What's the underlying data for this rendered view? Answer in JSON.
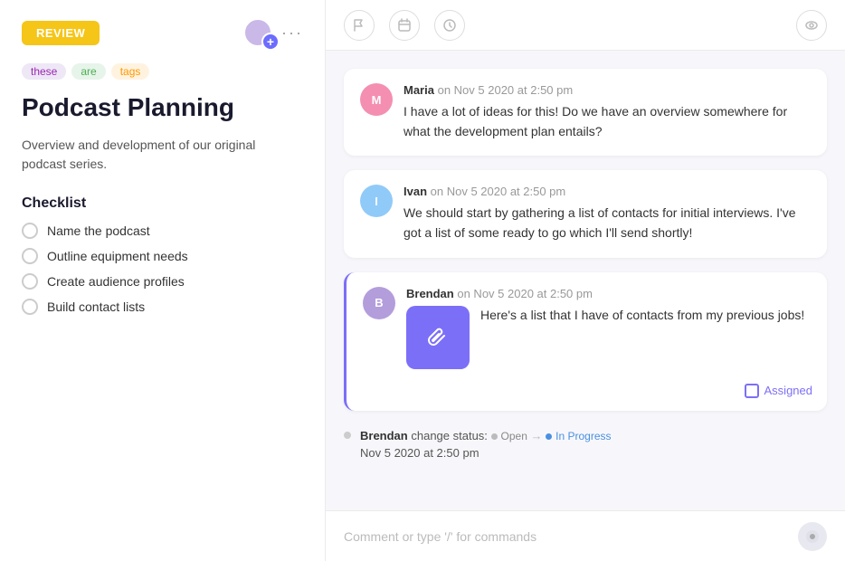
{
  "left": {
    "review_button": "REVIEW",
    "more_dots": "···",
    "tags": [
      {
        "label": "these",
        "style": "purple"
      },
      {
        "label": "are",
        "style": "green"
      },
      {
        "label": "tags",
        "style": "orange"
      }
    ],
    "title": "Podcast Planning",
    "description": "Overview and development of our original podcast series.",
    "checklist_title": "Checklist",
    "checklist_items": [
      {
        "label": "Name the podcast"
      },
      {
        "label": "Outline equipment needs"
      },
      {
        "label": "Create audience profiles"
      },
      {
        "label": "Build contact lists"
      }
    ]
  },
  "right": {
    "header_icons": {
      "flag": "⚑",
      "calendar": "▭",
      "clock": "◷",
      "eye": "◎"
    },
    "comments": [
      {
        "author": "Maria",
        "meta": "on Nov 5 2020 at 2:50 pm",
        "text": "I have a lot of ideas for this! Do we have an overview somewhere for what the development plan entails?",
        "avatar_initials": "M",
        "avatar_color": "pink",
        "highlighted": false
      },
      {
        "author": "Ivan",
        "meta": "on Nov 5 2020 at 2:50 pm",
        "text": "We should start by gathering a list of contacts for initial interviews. I've got a list of some ready to go which I'll send shortly!",
        "avatar_initials": "I",
        "avatar_color": "blue",
        "highlighted": false
      },
      {
        "author": "Brendan",
        "meta": "on Nov 5 2020 at 2:50 pm",
        "text": "Here's a list that I have of contacts from my previous jobs!",
        "avatar_initials": "B",
        "avatar_color": "purple",
        "highlighted": true,
        "has_attachment": true,
        "assigned_label": "Assigned"
      }
    ],
    "status_event": {
      "author": "Brendan",
      "action": "change status:",
      "from": "Open",
      "arrow": "→",
      "to": "In Progress",
      "timestamp": "Nov 5 2020 at 2:50 pm"
    },
    "comment_placeholder": "Comment or type '/' for commands",
    "send_icon": "💬"
  }
}
